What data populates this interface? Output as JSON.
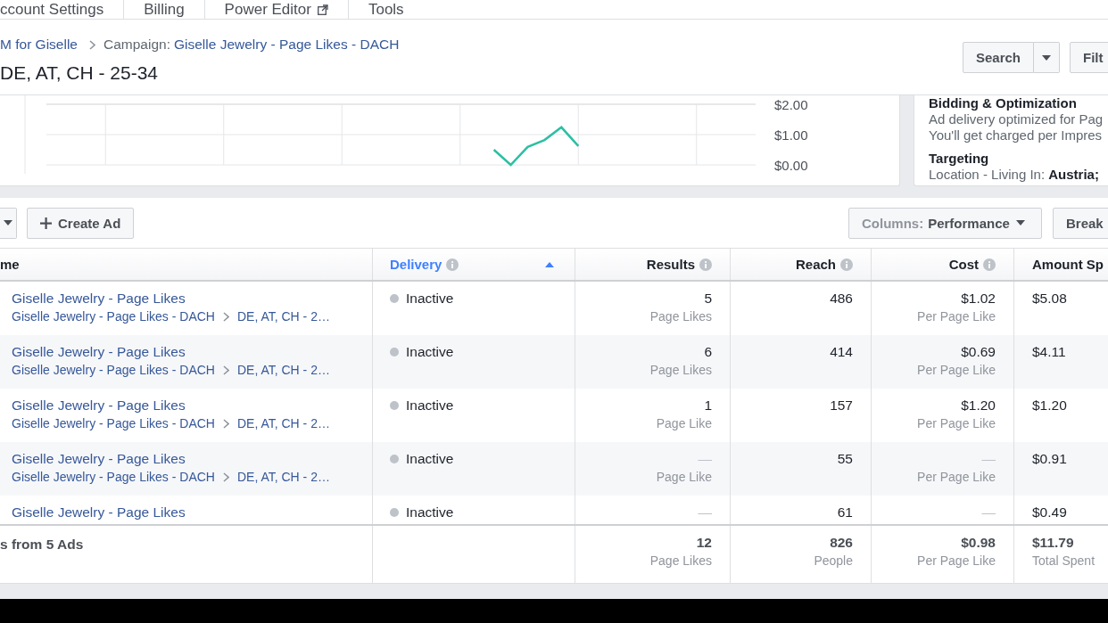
{
  "top_nav": {
    "items": [
      {
        "label": "ccount Settings",
        "external": false
      },
      {
        "label": "Billing",
        "external": false
      },
      {
        "label": "Power Editor",
        "external": true
      },
      {
        "label": "Tools",
        "external": false
      }
    ]
  },
  "breadcrumb": {
    "account": "M for Giselle",
    "campaign_label": "Campaign:",
    "campaign": "Giselle Jewelry - Page Likes - DACH"
  },
  "title": "DE, AT, CH - 25-34",
  "header_actions": {
    "search": "Search",
    "filter": "Filt"
  },
  "performance_chart": {
    "chart_data": {
      "type": "line",
      "grid": true,
      "ylim": [
        0,
        2
      ],
      "yticks": [
        {
          "value": 2,
          "label": "$2.00"
        },
        {
          "value": 1,
          "label": "$1.00"
        },
        {
          "value": 0,
          "label": "$0.00"
        }
      ],
      "series": [
        {
          "color": "#2cbfa3",
          "values": [
            null,
            null,
            null,
            null,
            null,
            null,
            null,
            null,
            null,
            null,
            null,
            null,
            null,
            null,
            null,
            null,
            null,
            null,
            null,
            null,
            null,
            null,
            null,
            null,
            null,
            null,
            0.5,
            0,
            0.59,
            0.82,
            1.24,
            0.62,
            null,
            null,
            null,
            null,
            null,
            null,
            null,
            null,
            null,
            null
          ]
        }
      ]
    }
  },
  "summary": {
    "sections": [
      {
        "heading": "Bidding & Optimization",
        "lines": [
          "Ad delivery optimized for Pag",
          "You'll get charged per Impres"
        ]
      },
      {
        "heading": "Targeting",
        "lines": [
          "Location - Living In: **Austria;**"
        ]
      }
    ]
  },
  "toolbar": {
    "create": "Create Ad",
    "columns": {
      "label": "Columns:",
      "value": "Performance"
    },
    "breakdown": "Break"
  },
  "table": {
    "columns": [
      {
        "label": "me",
        "info": false,
        "sorted": false
      },
      {
        "label": "Delivery",
        "info": true,
        "sorted": true
      },
      {
        "label": "Results",
        "info": true,
        "sorted": false
      },
      {
        "label": "Reach",
        "info": true,
        "sorted": false
      },
      {
        "label": "Cost",
        "info": true,
        "sorted": false
      },
      {
        "label": "Amount Sp",
        "sorted": false
      }
    ],
    "rows": [
      {
        "name": "Giselle Jewelry - Page Likes",
        "campaign": "Giselle Jewelry - Page Likes - DACH",
        "ad_set": "DE, AT, CH - 2…",
        "delivery": {
          "status": "Inactive",
          "color": "#bec3c9"
        },
        "results": {
          "value": "5",
          "unit": "Page Likes",
          "empty": false
        },
        "reach": "486",
        "cost": {
          "value": "$1.02",
          "unit": "Per Page Like",
          "empty": false
        },
        "amount_spent": "$5.08"
      },
      {
        "name": "Giselle Jewelry - Page Likes",
        "campaign": "Giselle Jewelry - Page Likes - DACH",
        "ad_set": "DE, AT, CH - 2…",
        "delivery": {
          "status": "Inactive",
          "color": "#bec3c9"
        },
        "results": {
          "value": "6",
          "unit": "Page Likes",
          "empty": false
        },
        "reach": "414",
        "cost": {
          "value": "$0.69",
          "unit": "Per Page Like",
          "empty": false
        },
        "amount_spent": "$4.11"
      },
      {
        "name": "Giselle Jewelry - Page Likes",
        "campaign": "Giselle Jewelry - Page Likes - DACH",
        "ad_set": "DE, AT, CH - 2…",
        "delivery": {
          "status": "Inactive",
          "color": "#bec3c9"
        },
        "results": {
          "value": "1",
          "unit": "Page Like",
          "empty": false
        },
        "reach": "157",
        "cost": {
          "value": "$1.20",
          "unit": "Per Page Like",
          "empty": false
        },
        "amount_spent": "$1.20"
      },
      {
        "name": "Giselle Jewelry - Page Likes",
        "campaign": "Giselle Jewelry - Page Likes - DACH",
        "ad_set": "DE, AT, CH - 2…",
        "delivery": {
          "status": "Inactive",
          "color": "#bec3c9"
        },
        "results": {
          "value": "—",
          "unit": "Page Like",
          "empty": true
        },
        "reach": "55",
        "cost": {
          "value": "—",
          "unit": "Per Page Like",
          "empty": true
        },
        "amount_spent": "$0.91"
      },
      {
        "name": "Giselle Jewelry - Page Likes",
        "delivery": {
          "status": "Inactive",
          "color": "#bec3c9"
        },
        "results": {
          "value": "—",
          "empty": true
        },
        "reach": "61",
        "cost": {
          "value": "—",
          "empty": true
        },
        "amount_spent": "$0.49"
      }
    ],
    "totals": {
      "label": "s from 5 Ads",
      "results": {
        "value": "12",
        "unit": "Page Likes"
      },
      "reach": {
        "value": "826",
        "unit": "People"
      },
      "cost": {
        "value": "$0.98",
        "unit": "Per Page Like"
      },
      "amount_spent": {
        "value": "$11.79",
        "unit": "Total Spent"
      }
    }
  }
}
